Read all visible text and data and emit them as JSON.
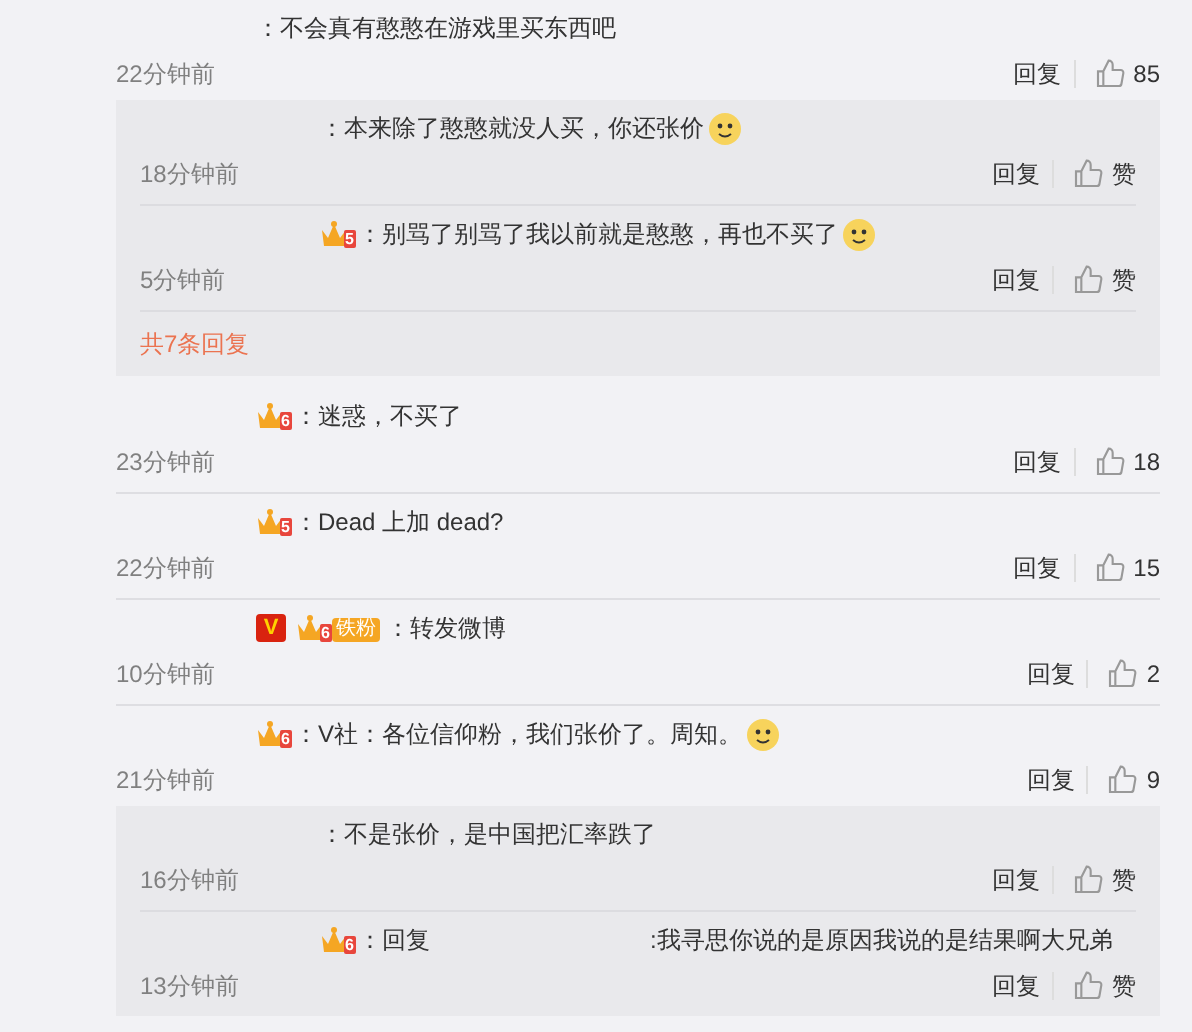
{
  "comments": [
    {
      "text": "：不会真有憨憨在游戏里买东西吧",
      "emoji": false,
      "time": "22分钟前",
      "reply_label": "回复",
      "like": "85",
      "replies": [
        {
          "text": "：本来除了憨憨就没人买，你还张价",
          "emoji": true,
          "time": "18分钟前",
          "reply_label": "回复",
          "like": "赞"
        },
        {
          "badges": [
            {
              "kind": "crown",
              "label": "5"
            }
          ],
          "text": "：别骂了别骂了我以前就是憨憨，再也不买了",
          "emoji": true,
          "time": "5分钟前",
          "reply_label": "回复",
          "like": "赞"
        }
      ],
      "more": "共7条回复"
    },
    {
      "badges": [
        {
          "kind": "crown",
          "label": "6"
        }
      ],
      "text": "：迷惑，不买了",
      "emoji": false,
      "time": "23分钟前",
      "reply_label": "回复",
      "like": "18"
    },
    {
      "badges": [
        {
          "kind": "crown",
          "label": "5"
        }
      ],
      "text": "：Dead 上加 dead?",
      "emoji": false,
      "time": "22分钟前",
      "reply_label": "回复",
      "like": "15"
    },
    {
      "badges": [
        {
          "kind": "verified",
          "label": "V"
        },
        {
          "kind": "fan",
          "label": "6",
          "tag": "铁粉"
        }
      ],
      "text": "：转发微博",
      "emoji": false,
      "time": "10分钟前",
      "reply_label": "回复",
      "like": "2"
    },
    {
      "badges": [
        {
          "kind": "crown",
          "label": "6"
        }
      ],
      "text": "：V社：各位信仰粉，我们张价了。周知。",
      "emoji": true,
      "time": "21分钟前",
      "reply_label": "回复",
      "like": "9",
      "replies": [
        {
          "text": "：不是张价，是中国把汇率跌了",
          "emoji": false,
          "time": "16分钟前",
          "reply_label": "回复",
          "like": "赞"
        },
        {
          "badges": [
            {
              "kind": "crown",
              "label": "6"
            }
          ],
          "prefix": "：回复",
          "text": ":我寻思你说的是原因我说的是结果啊大兄弟",
          "emoji": false,
          "time": "13分钟前",
          "reply_label": "回复",
          "like": "赞"
        }
      ]
    }
  ]
}
